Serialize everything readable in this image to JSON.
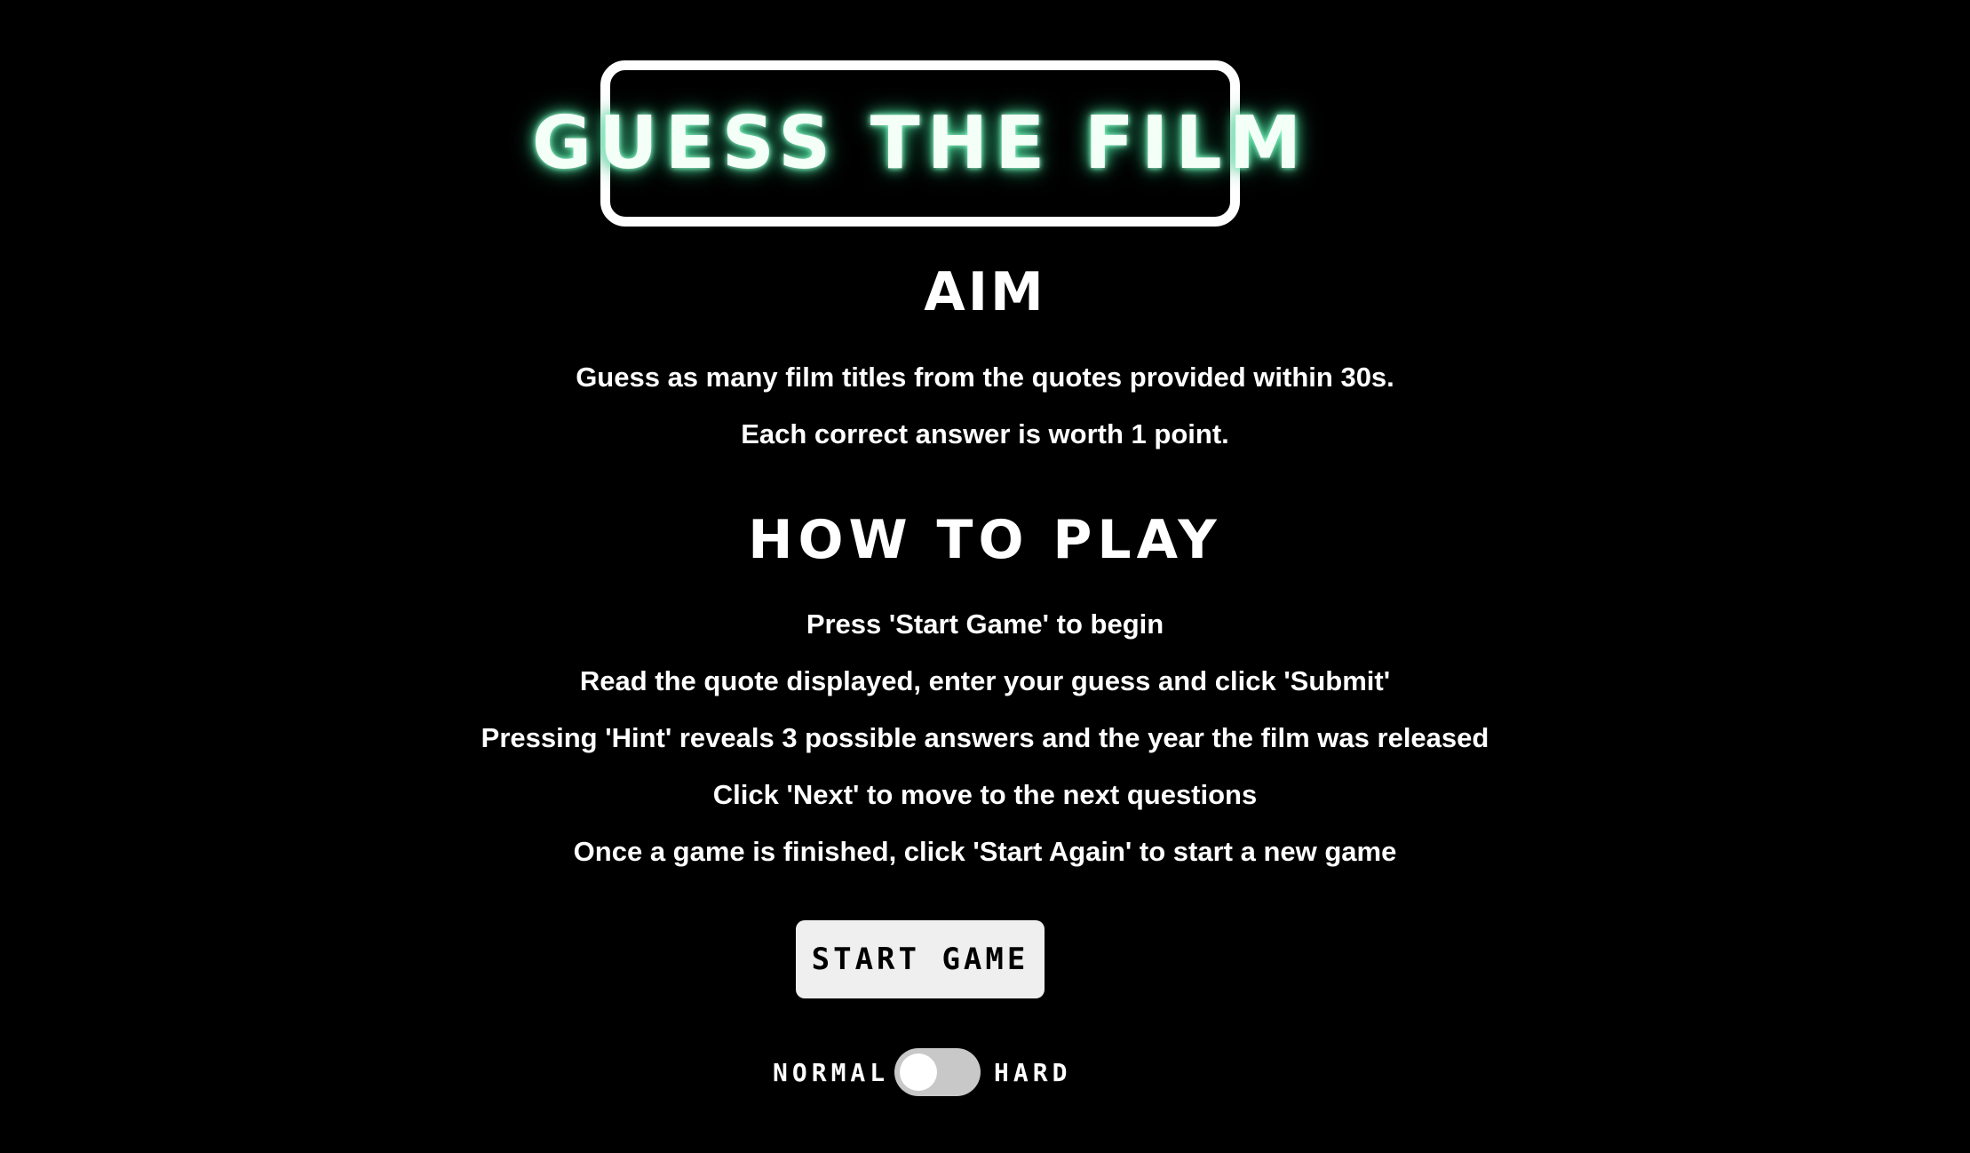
{
  "header": {
    "title": "GUESS THE FILM"
  },
  "aim": {
    "heading": "AIM",
    "lines": [
      "Guess as many film titles from the quotes provided within 30s.",
      "Each correct answer is worth 1 point."
    ]
  },
  "how_to_play": {
    "heading": "HOW TO PLAY",
    "steps": [
      "Press 'Start Game' to begin",
      "Read the quote displayed, enter your guess and click 'Submit'",
      "Pressing 'Hint' reveals 3 possible answers and the year the film was released",
      "Click 'Next' to move to the next questions",
      "Once a game is finished, click 'Start Again' to start a new game"
    ]
  },
  "controls": {
    "start_button_label": "START GAME",
    "difficulty": {
      "left_label": "NORMAL",
      "right_label": "HARD",
      "selected": "NORMAL"
    }
  },
  "colors": {
    "background": "#000000",
    "text": "#ffffff",
    "title_glow": "#4fd79a",
    "button_bg": "#efefef",
    "switch_track": "#c8c8c8"
  }
}
